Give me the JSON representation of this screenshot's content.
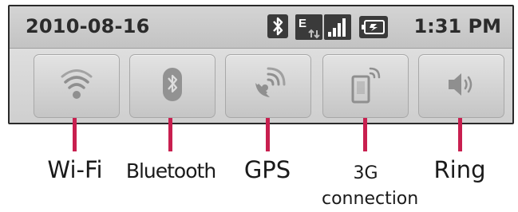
{
  "status_bar": {
    "date": "2010-08-16",
    "time": "1:31 PM",
    "icons": [
      "bluetooth-icon",
      "edge-data-icon",
      "signal-bars-icon",
      "battery-icon"
    ]
  },
  "quick_settings": [
    {
      "id": "wifi",
      "icon": "wifi-icon"
    },
    {
      "id": "bluetooth",
      "icon": "bluetooth-icon"
    },
    {
      "id": "gps",
      "icon": "gps-satellite-icon"
    },
    {
      "id": "3g",
      "icon": "mobile-data-icon"
    },
    {
      "id": "ring",
      "icon": "speaker-icon"
    }
  ],
  "labels": {
    "wifi": "Wi-Fi",
    "bluetooth": "Bluetooth",
    "gps": "GPS",
    "g3_line1": "3G",
    "g3_line2": "connection",
    "ring": "Ring"
  },
  "colors": {
    "pointer": "#c81f4f",
    "icon_gray": "#8f8f8f"
  }
}
